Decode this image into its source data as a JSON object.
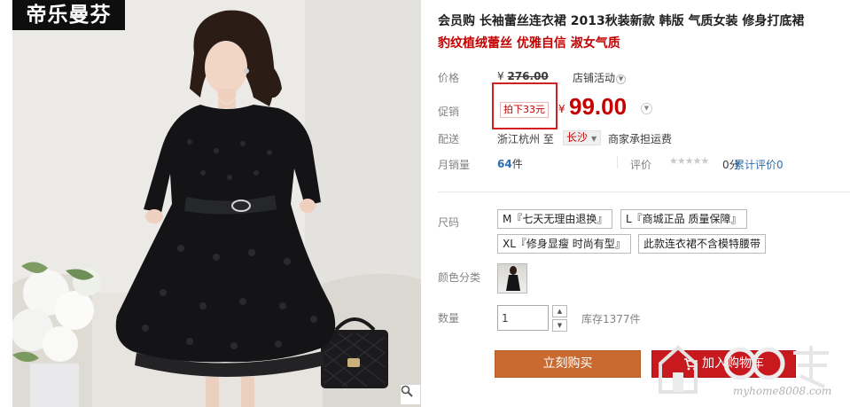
{
  "image": {
    "brand_logo_text": "帝乐曼芬"
  },
  "product": {
    "title": "会员购 长袖蕾丝连衣裙 2013秋装新款 韩版 气质女装 修身打底裙",
    "subtitle": "豹纹植绒蕾丝 优雅自信 淑女气质"
  },
  "price_row": {
    "label": "价格",
    "currency": "¥",
    "original_price": "276.00",
    "store_activity": "店铺活动"
  },
  "promo_row": {
    "label": "促销",
    "promo_tag": "拍下33元",
    "currency": "¥",
    "promo_price": "99.00"
  },
  "shipping_row": {
    "label": "配送",
    "from": "浙江杭州",
    "to_word": "至",
    "destination": "长沙",
    "freight": "商家承担运费"
  },
  "sales_row": {
    "label": "月销量",
    "count": "64",
    "unit": "件",
    "rating_label": "评价",
    "rating_stars": 0,
    "rating_score": "0分",
    "reviews": "累计评价0"
  },
  "size_row": {
    "label": "尺码",
    "options": [
      "M『七天无理由退换』",
      "L『商城正品 质量保障』",
      "XL『修身显瘦 时尚有型』",
      "此款连衣裙不含模特腰带"
    ]
  },
  "color_row": {
    "label": "颜色分类"
  },
  "quantity_row": {
    "label": "数量",
    "value": "1",
    "stock": "库存1377件"
  },
  "actions": {
    "buy_now": "立刻购买",
    "add_to_cart": "加入购物车"
  },
  "watermark": {
    "text": "myhome8008.com"
  },
  "colors": {
    "accent_red": "#c40000",
    "buy_button": "#c96b31",
    "cart_button": "#c8191e",
    "link_blue": "#2e6dae"
  }
}
